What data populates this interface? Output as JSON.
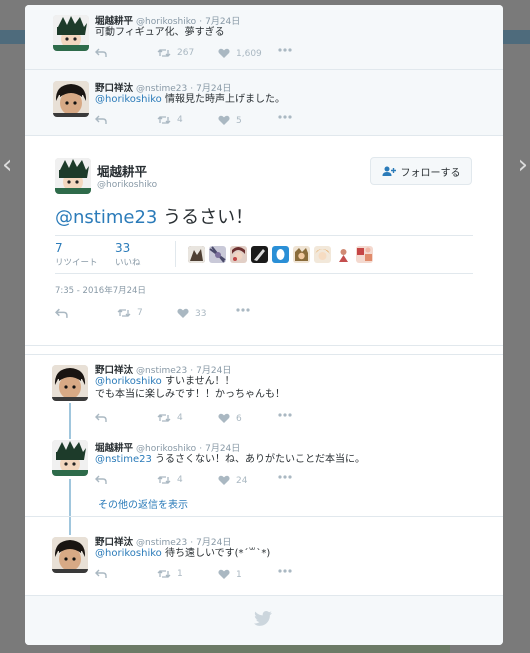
{
  "nav": {
    "prev_icon": "chevron-left-icon",
    "next_icon": "chevron-right-icon"
  },
  "ancestors": [
    {
      "name": "堀越耕平",
      "handle": "@horikoshiko",
      "time": "7月24日",
      "text": "可動フィギュア化、夢すぎる",
      "retweets": "267",
      "likes": "1,609"
    },
    {
      "name": "野口祥汰",
      "handle": "@nstime23",
      "time": "7月24日",
      "mention": "@horikoshiko",
      "text": " 情報見た時声上げました。",
      "retweets": "4",
      "likes": "5"
    }
  ],
  "main": {
    "name": "堀越耕平",
    "handle": "@horikoshiko",
    "follow_label": "フォローする",
    "mention": "@nstime23",
    "text": " うるさい！",
    "retweets_num": "7",
    "retweets_label": "リツイート",
    "likes_num": "33",
    "likes_label": "いいね",
    "date": "7:35 - 2016年7月24日",
    "action_retweets": "7",
    "action_likes": "33"
  },
  "replies": [
    {
      "name": "野口祥汰",
      "handle": "@nstime23",
      "time": "7月24日",
      "mention": "@horikoshiko",
      "text": " すいません！！",
      "text2": "でも本当に楽しみです！！かっちゃんも！",
      "retweets": "4",
      "likes": "6"
    },
    {
      "name": "堀越耕平",
      "handle": "@horikoshiko",
      "time": "7月24日",
      "mention": "@nstime23",
      "text": " うるさくない！ね、ありがたいことだ本当に。",
      "retweets": "4",
      "likes": "24"
    },
    {
      "name": "野口祥汰",
      "handle": "@nstime23",
      "time": "7月24日",
      "mention": "@horikoshiko",
      "text": " 待ち遠しいです(*´꒳`*)",
      "retweets": "1",
      "likes": "1"
    }
  ],
  "more_replies_label": "その他の返信を表示",
  "colors": {
    "link": "#2b7bb9",
    "muted": "#8899a6",
    "thread": "#a0c6dd"
  }
}
